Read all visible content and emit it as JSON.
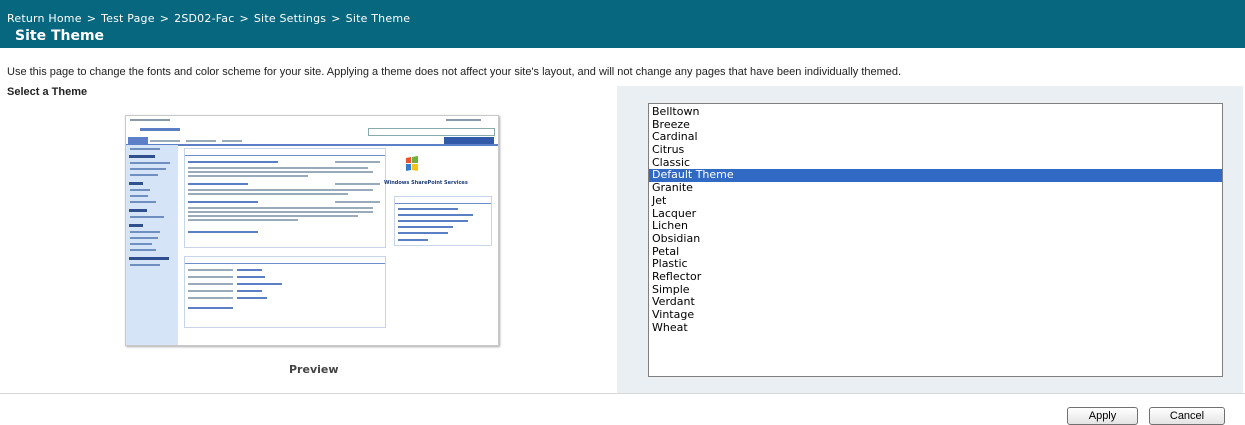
{
  "breadcrumb": {
    "items": [
      "Return Home",
      "Test Page",
      "2SD02-Fac",
      "Site Settings",
      "Site Theme"
    ],
    "separator": ">"
  },
  "page": {
    "title": "Site Theme",
    "description": "Use this page to change the fonts and color scheme for your site. Applying a theme does not affect your site's layout, and will not change any pages that have been individually themed.",
    "section_label": "Select a Theme",
    "preview_label": "Preview"
  },
  "preview": {
    "logo_text": "Windows SharePoint Services"
  },
  "themes": {
    "items": [
      "Belltown",
      "Breeze",
      "Cardinal",
      "Citrus",
      "Classic",
      "Default Theme",
      "Granite",
      "Jet",
      "Lacquer",
      "Lichen",
      "Obsidian",
      "Petal",
      "Plastic",
      "Reflector",
      "Simple",
      "Verdant",
      "Vintage",
      "Wheat"
    ],
    "selected": "Default Theme"
  },
  "buttons": {
    "apply": "Apply",
    "cancel": "Cancel"
  },
  "colors": {
    "title_bar": "#07677f",
    "selection": "#316ac5",
    "right_panel": "#e9eff2"
  }
}
